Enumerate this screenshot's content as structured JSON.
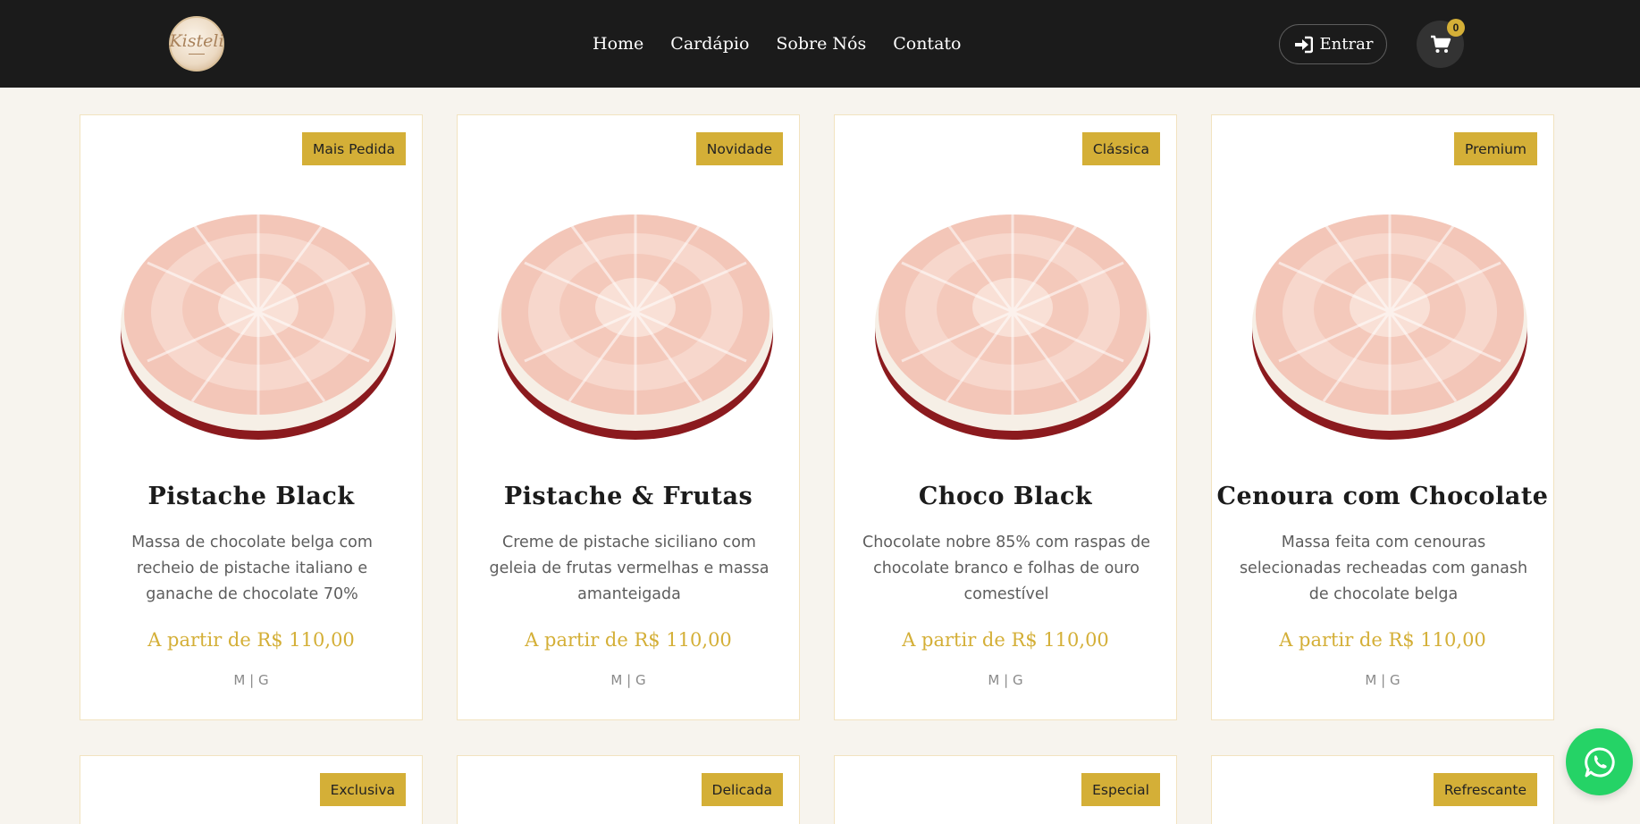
{
  "brand": {
    "logo_text": "Kisteli"
  },
  "nav": {
    "items": [
      "Home",
      "Cardápio",
      "Sobre Nós",
      "Contato"
    ]
  },
  "header": {
    "login_label": "Entrar",
    "cart_count": "0"
  },
  "products": [
    {
      "badge": "Mais Pedida",
      "title": "Pistache Black",
      "description": "Massa de chocolate belga com recheio de pistache italiano e ganache de chocolate 70%",
      "price": "A partir de R$ 110,00",
      "sizes": "M | G"
    },
    {
      "badge": "Novidade",
      "title": "Pistache & Frutas",
      "description": "Creme de pistache siciliano com geleia de frutas vermelhas e massa amanteigada",
      "price": "A partir de R$ 110,00",
      "sizes": "M | G"
    },
    {
      "badge": "Clássica",
      "title": "Choco Black",
      "description": "Chocolate nobre 85% com raspas de chocolate branco e folhas de ouro comestível",
      "price": "A partir de R$ 110,00",
      "sizes": "M | G"
    },
    {
      "badge": "Premium",
      "title": "Cenoura com Chocolate",
      "description": "Massa feita com cenouras selecionadas recheadas com ganash de chocolate belga",
      "price": "A partir de R$ 110,00",
      "sizes": "M | G"
    }
  ],
  "products_row2": [
    {
      "badge": "Exclusiva"
    },
    {
      "badge": "Delicada"
    },
    {
      "badge": "Especial"
    },
    {
      "badge": "Refrescante"
    }
  ],
  "icons": {
    "login": "sign-in-icon",
    "cart": "shopping-cart-icon",
    "whatsapp": "whatsapp-icon",
    "product_image": "red-velvet-cake-image"
  },
  "colors": {
    "header_bg": "#1b1b1b",
    "accent_gold": "#d4af37",
    "page_bg": "#f7f4ee",
    "whatsapp_green": "#25d366"
  }
}
